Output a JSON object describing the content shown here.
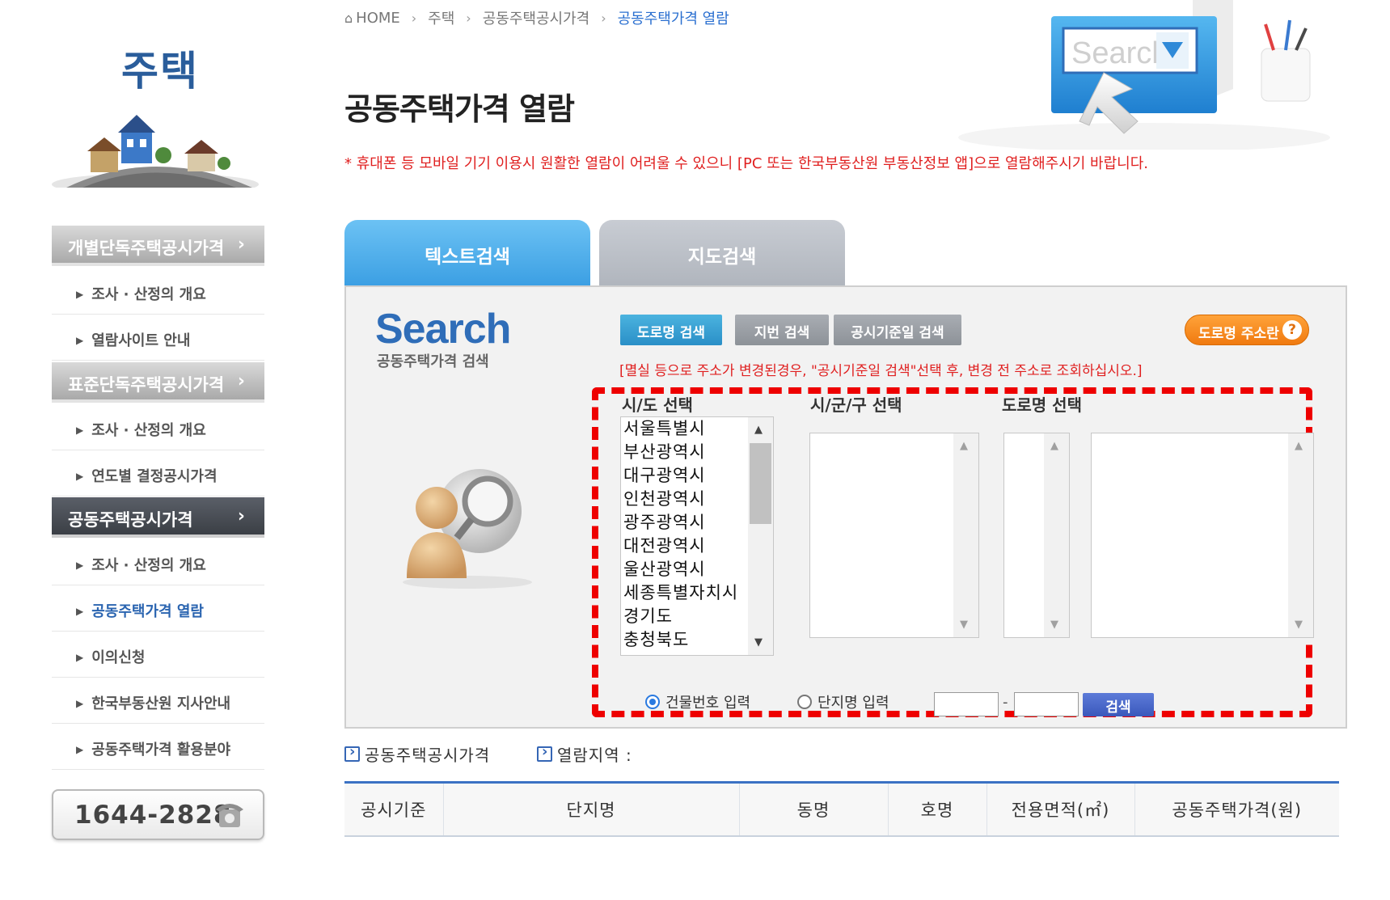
{
  "sidebar": {
    "title": "주택",
    "categories": [
      {
        "label": "개별단독주택공시가격",
        "items": [
          "조사 · 산정의 개요",
          "열람사이트 안내"
        ]
      },
      {
        "label": "표준단독주택공시가격",
        "items": [
          "조사 · 산정의 개요",
          "연도별 결정공시가격"
        ]
      },
      {
        "label": "공동주택공시가격",
        "items": [
          "조사 · 산정의 개요",
          "공동주택가격 열람",
          "이의신청",
          "한국부동산원 지사안내",
          "공동주택가격 활용분야"
        ],
        "active_item": "공동주택가격 열람"
      }
    ],
    "active_category": "공동주택공시가격",
    "phone": "1644-2828"
  },
  "breadcrumb": [
    "HOME",
    "주택",
    "공동주택공시가격",
    "공동주택가격 열람"
  ],
  "page_title": "공동주택가격 열람",
  "notice": "* 휴대폰 등 모바일 기기 이용시 원활한 열람이 어려울 수 있으니 [PC 또는 한국부동산원 부동산정보 앱]으로 열람해주시기 바랍니다.",
  "header_illustration_text": "Search",
  "tabs": [
    "텍스트검색",
    "지도검색"
  ],
  "active_tab": "텍스트검색",
  "search_panel": {
    "logo": "Search",
    "subtitle": "공동주택가격 검색",
    "search_types": [
      "도로명 검색",
      "지번 검색",
      "공시기준일 검색"
    ],
    "active_search_type": "도로명 검색",
    "road_address_button": "도로명 주소란",
    "warning": "[멸실 등으로 주소가 변경된경우, \"공시기준일 검색\"선택 후, 변경 전 주소로 조회하십시오.]",
    "columns": [
      "시/도 선택",
      "시/군/구 선택",
      "도로명 선택"
    ],
    "sido_options": [
      "서울특별시",
      "부산광역시",
      "대구광역시",
      "인천광역시",
      "광주광역시",
      "대전광역시",
      "울산광역시",
      "세종특별자치시",
      "경기도",
      "충청북도"
    ],
    "radio_options": [
      "건물번호 입력",
      "단지명 입력"
    ],
    "selected_radio": "건물번호 입력",
    "input_separator": "-",
    "search_button": "검색"
  },
  "info": {
    "price_label": "공동주택공시가격",
    "region_label": "열람지역 :"
  },
  "table": {
    "headers": [
      "공시기준",
      "단지명",
      "동명",
      "호명",
      "전용면적(㎡)",
      "공동주택가격(원)"
    ]
  },
  "colors": {
    "accent_blue": "#3b9fe3",
    "notice_red": "#e02020",
    "highlight_dash": "#ee0000"
  }
}
